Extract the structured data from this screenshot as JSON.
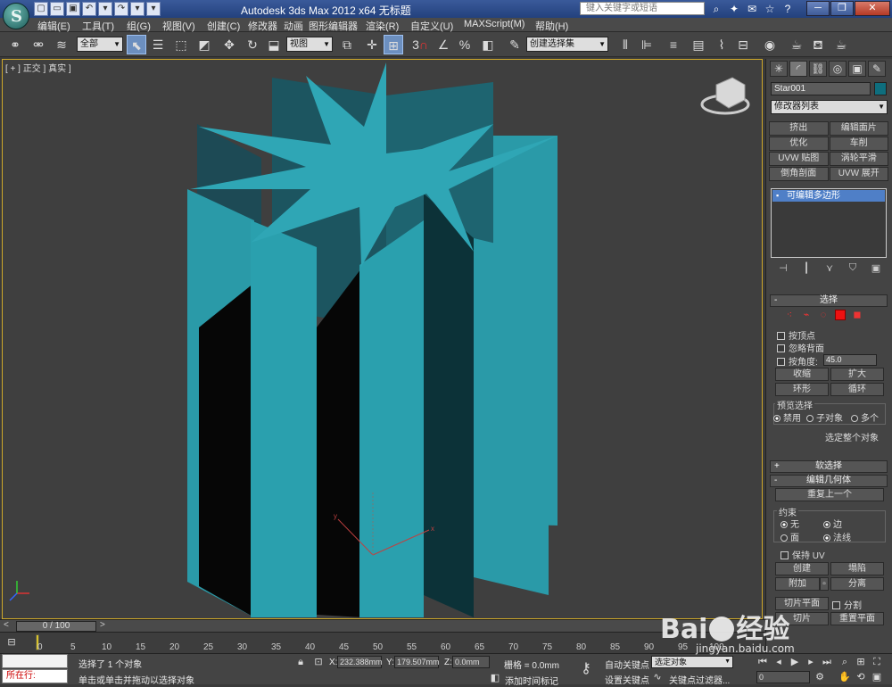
{
  "window": {
    "title": "Autodesk 3ds Max  2012 x64      无标题",
    "search_placeholder": "键入关键字或短语",
    "quick_access": [
      "file-new-icon",
      "file-open-icon",
      "save-icon",
      "undo-icon",
      "redo-icon",
      "dropdown-icon"
    ],
    "controls": {
      "min": "─",
      "restore": "❐",
      "close": "✕"
    }
  },
  "menu": [
    "编辑(E)",
    "工具(T)",
    "组(G)",
    "视图(V)",
    "创建(C)",
    "修改器",
    "动画",
    "图形编辑器",
    "渲染(R)",
    "自定义(U)",
    "MAXScript(M)",
    "帮助(H)"
  ],
  "toolbar": {
    "selection_filter": "全部",
    "ref_coord": "视图",
    "named_selection": "创建选择集"
  },
  "viewport": {
    "label": "[ + ] 正交 ] 真实 ]",
    "object_color": "#2a9aa8",
    "axis": {
      "x": "x",
      "y": "y",
      "z": "z"
    }
  },
  "command_panel": {
    "object_name": "Star001",
    "object_color": "#0e6e7e",
    "modifier_list": "修改器列表",
    "modifier_buttons": [
      "挤出",
      "编辑面片",
      "优化",
      "车削",
      "UVW 贴图",
      "涡轮平滑",
      "倒角剖面",
      "UVW 展开"
    ],
    "stack_item": "可编辑多边形",
    "selection": {
      "title": "选择",
      "by_vertex": "按顶点",
      "ignore_backfacing": "忽略背面",
      "by_angle": "按角度:",
      "angle_value": "45.0",
      "shrink": "收缩",
      "grow": "扩大",
      "ring": "环形",
      "loop": "循环",
      "preview_title": "预览选择",
      "preview_off": "禁用",
      "preview_subobj": "子对象",
      "preview_multi": "多个",
      "select_whole": "选定整个对象"
    },
    "soft_selection": "软选择",
    "edit_geometry": {
      "title": "编辑几何体",
      "repeat_last": "重复上一个",
      "constraints": "约束",
      "c_none": "无",
      "c_edge": "边",
      "c_face": "面",
      "c_normal": "法线",
      "preserve_uv": "保持 UV",
      "create": "创建",
      "collapse": "塌陷",
      "attach": "附加",
      "detach": "分离",
      "slice_plane": "切片平面",
      "split": "分割",
      "reset_plane": "重置平面",
      "slice": "切片"
    }
  },
  "timeline": {
    "frame_display": "0 / 100",
    "ticks": [
      "0",
      "5",
      "10",
      "15",
      "20",
      "25",
      "30",
      "35",
      "40",
      "45",
      "50",
      "55",
      "60",
      "65",
      "70",
      "75",
      "80",
      "85",
      "90",
      "95",
      "100"
    ]
  },
  "status": {
    "maxscript_prompt": "所在行:",
    "selected_text": "选择了 1 个对象",
    "hint_text": "单击或单击并拖动以选择对象",
    "x_label": "X:",
    "x_value": "232.388mm",
    "y_label": "Y:",
    "y_value": "179.507mm",
    "z_label": "Z:",
    "z_value": "0.0mm",
    "grid": "栅格 = 0.0mm",
    "add_time_tag": "添加时间标记",
    "auto_key": "自动关键点",
    "set_key": "设置关键点",
    "selected_dd": "选定对象",
    "key_filters": "关键点过滤器...",
    "frame_field": "0"
  },
  "watermark": {
    "brand": "Bai",
    "brand2": "经验",
    "url": "jingyan.baidu.com"
  }
}
